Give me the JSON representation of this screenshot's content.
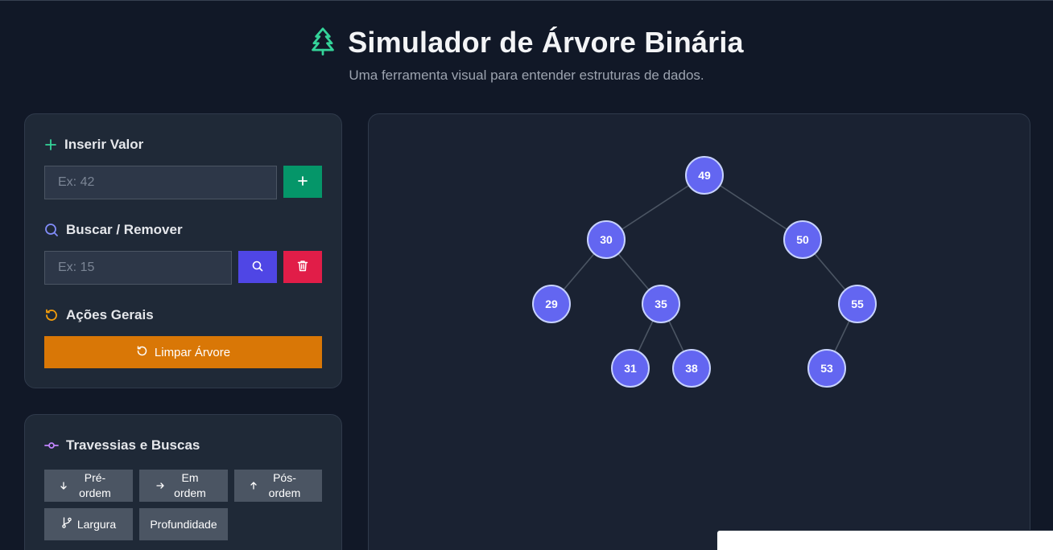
{
  "header": {
    "title": "Simulador de Árvore Binária",
    "subtitle": "Uma ferramenta visual para entender estruturas de dados."
  },
  "insert": {
    "title": "Inserir Valor",
    "placeholder": "Ex: 42",
    "add_icon": "plus-icon"
  },
  "search": {
    "title": "Buscar / Remover",
    "placeholder": "Ex: 15",
    "search_icon": "search-icon",
    "delete_icon": "trash-icon"
  },
  "actions": {
    "title": "Ações Gerais",
    "clear_label": "Limpar Árvore"
  },
  "traversal": {
    "title": "Travessias e Buscas",
    "preorder": "Pré-ordem",
    "inorder": "Em ordem",
    "postorder": "Pós-ordem",
    "bfs": "Largura",
    "dfs": "Profundidade"
  },
  "tree": {
    "nodes": [
      {
        "value": 49,
        "parent": null,
        "side": null
      },
      {
        "value": 30,
        "parent": 49,
        "side": "left"
      },
      {
        "value": 50,
        "parent": 49,
        "side": "right"
      },
      {
        "value": 29,
        "parent": 30,
        "side": "left"
      },
      {
        "value": 35,
        "parent": 30,
        "side": "right"
      },
      {
        "value": 55,
        "parent": 50,
        "side": "right"
      },
      {
        "value": 31,
        "parent": 35,
        "side": "left"
      },
      {
        "value": 38,
        "parent": 35,
        "side": "right"
      },
      {
        "value": 53,
        "parent": 55,
        "side": "left"
      }
    ]
  },
  "colors": {
    "node_fill": "#6366f1",
    "node_stroke": "#c7d2fe",
    "edge": "#4b5563",
    "accent_green": "#059669",
    "accent_indigo": "#4f46e5",
    "accent_red": "#e11d48",
    "accent_orange": "#d97706"
  }
}
